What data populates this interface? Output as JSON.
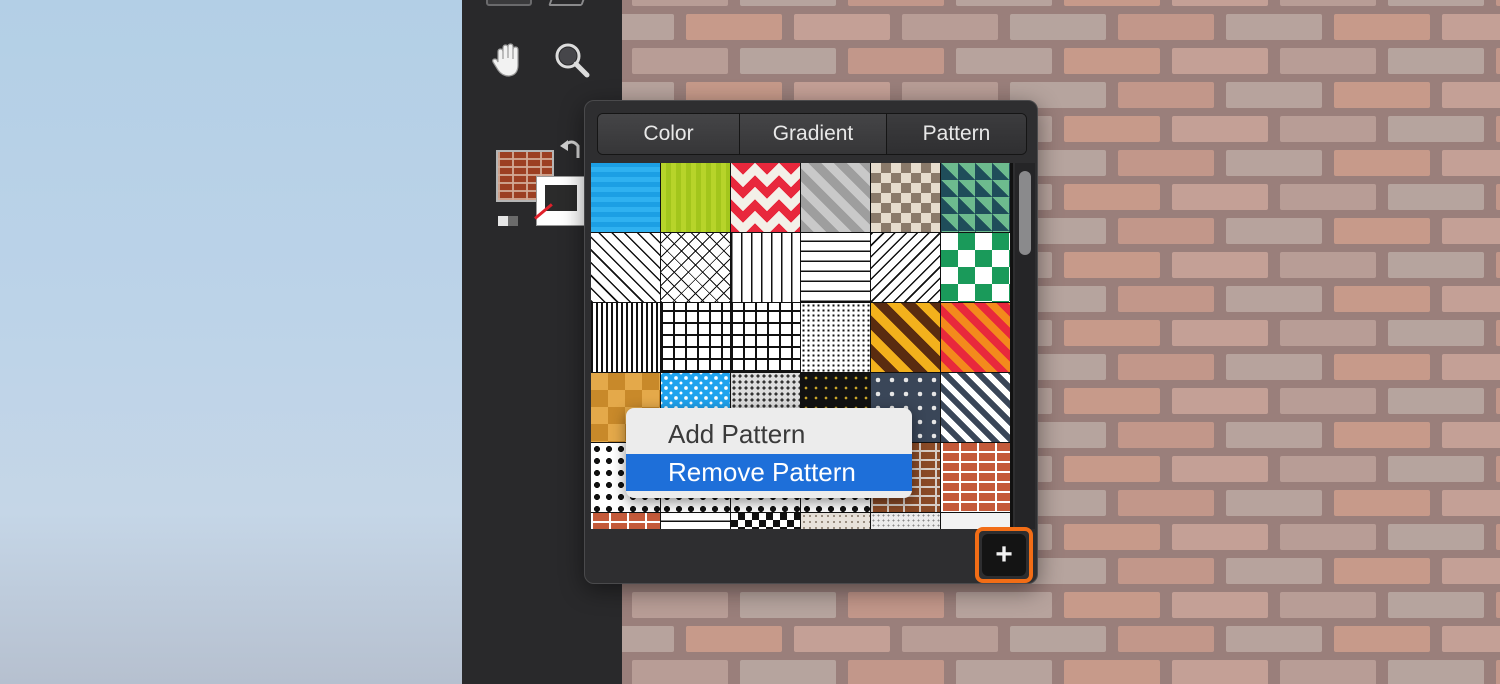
{
  "toolbar": {
    "tools": [
      {
        "name": "hand-tool",
        "icon": "hand-icon"
      },
      {
        "name": "zoom-tool",
        "icon": "magnifier-icon"
      }
    ],
    "fill": {
      "type": "brick pattern",
      "color": "#9c3f22"
    },
    "stroke": {
      "color": "#2b2b2b"
    }
  },
  "popover": {
    "tabs": [
      "Color",
      "Gradient",
      "Pattern"
    ],
    "active_tab": "Pattern",
    "add_button_label": "+",
    "highlight_color": "#f26d16"
  },
  "context_menu": {
    "items": [
      {
        "label": "Add Pattern",
        "highlighted": false
      },
      {
        "label": "Remove Pattern",
        "highlighted": true
      }
    ],
    "highlight_color": "#1e6fd9"
  }
}
